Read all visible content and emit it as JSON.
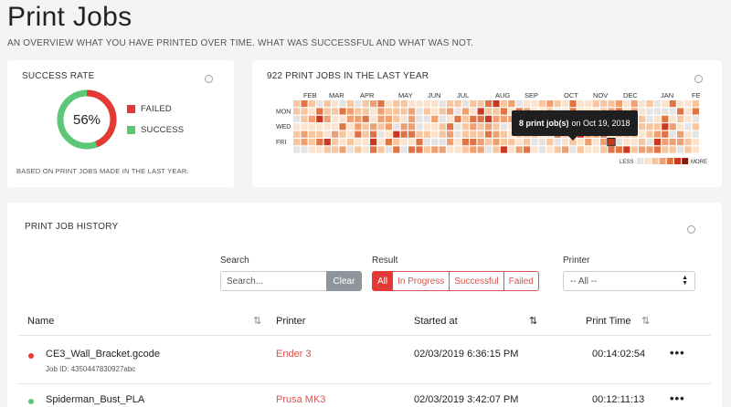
{
  "page": {
    "title": "Print Jobs",
    "subtitle": "AN OVERVIEW WHAT YOU HAVE PRINTED OVER TIME. WHAT WAS SUCCESSFUL AND WHAT WAS NOT."
  },
  "success": {
    "title": "SUCCESS RATE",
    "percent_label": "56%",
    "success_fraction": 0.56,
    "legend": [
      {
        "label": "FAILED",
        "color": "#e53935"
      },
      {
        "label": "SUCCESS",
        "color": "#5cc877"
      }
    ],
    "note": "BASED ON PRINT JOBS MADE IN THE LAST YEAR."
  },
  "heatmap": {
    "title": "922 PRINT JOBS IN THE LAST YEAR",
    "months": [
      "FEB",
      "MAR",
      "APR",
      "MAY",
      "JUN",
      "JUL",
      "AUG",
      "SEP",
      "OCT",
      "NOV",
      "DEC",
      "JAN",
      "FE"
    ],
    "weekdays": [
      "MON",
      "WED",
      "FRI"
    ],
    "legend_less": "LESS",
    "legend_more": "MORE",
    "scale_colors": [
      "#e4e4e4",
      "#fbe3cd",
      "#f7c59e",
      "#f0a070",
      "#e07445",
      "#c9381f",
      "#8b1a0e"
    ],
    "tooltip_bold": "8 print job(s)",
    "tooltip_rest": "on Oct 19, 2018"
  },
  "history": {
    "title": "PRINT JOB HISTORY",
    "search_label": "Search",
    "search_placeholder": "Search...",
    "clear_label": "Clear",
    "result_label": "Result",
    "result_options": [
      "All",
      "In Progress",
      "Successful",
      "Failed"
    ],
    "printer_label": "Printer",
    "printer_value": "-- All --",
    "columns": [
      "Name",
      "Printer",
      "Started at",
      "Print Time"
    ],
    "rows": [
      {
        "name": "CE3_Wall_Bracket.gcode",
        "job_id": "Job ID: 4350447830927abc",
        "printer": "Ender 3",
        "started": "02/03/2019 6:36:15 PM",
        "time": "00:14:02:54",
        "status_color": "#e53935"
      },
      {
        "name": "Spiderman_Bust_PLA",
        "job_id": "",
        "printer": "Prusa MK3",
        "started": "02/03/2019 3:42:07 PM",
        "time": "00:12:11:13",
        "status_color": "#5cc877"
      }
    ]
  }
}
